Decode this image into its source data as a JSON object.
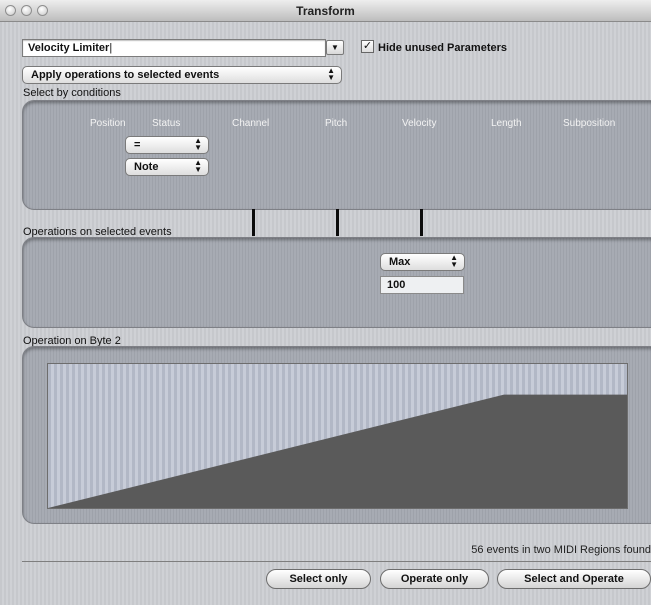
{
  "window": {
    "title": "Transform"
  },
  "preset": {
    "value": "Velocity Limiter",
    "dropdown_icon": "triangle-down-icon"
  },
  "hide_unused": {
    "label": "Hide unused Parameters",
    "checked": true,
    "check_glyph": "✓"
  },
  "mode_popup": {
    "value": "Apply operations to selected events"
  },
  "select_section": {
    "label": "Select by conditions",
    "columns": [
      "Position",
      "Status",
      "Channel",
      "Pitch",
      "Velocity",
      "Length",
      "Subposition"
    ],
    "status_condition": "=",
    "status_value": "Note"
  },
  "operations_section": {
    "label": "Operations on selected events",
    "velocity_operation": "Max",
    "velocity_value": "100"
  },
  "byte2_section": {
    "label": "Operation on Byte 2",
    "graph": {
      "input_range": [
        0,
        127
      ],
      "output_max": 100,
      "fill_color": "#5a5a5a"
    }
  },
  "status_text": "56 events in two MIDI Regions found",
  "buttons": {
    "select_only": "Select only",
    "operate_only": "Operate only",
    "select_and_operate": "Select and Operate"
  },
  "popup_arrows": "▲▼"
}
